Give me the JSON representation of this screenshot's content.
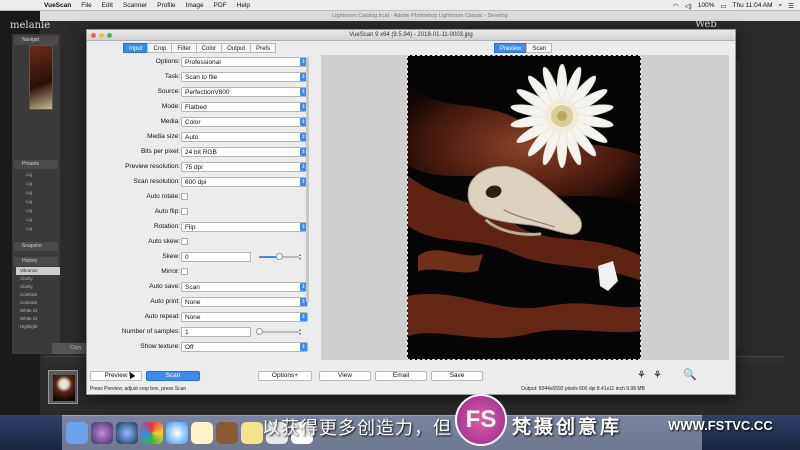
{
  "menubar": {
    "app": "VueScan",
    "items": [
      "File",
      "Edit",
      "Scanner",
      "Profile",
      "Image",
      "PDF",
      "Help"
    ],
    "battery": "100%",
    "clock": "Thu 11:04 AM"
  },
  "lightroom": {
    "window_title": "Lightroom Catalog.lrcat - Adobe Photoshop Lightroom Classic - Develop",
    "logo": "melanie",
    "module": "Web",
    "panels": {
      "navigator": "Navigat",
      "presets": "Presets",
      "snapshots": "Snapsho",
      "history": "History"
    },
    "presets_items": [
      "Lig",
      "Lig",
      "Lig",
      "Lig",
      "Lig",
      "Lig",
      "Lig"
    ],
    "history_items": [
      "Vibrance",
      "Clarity",
      "Clarity",
      "Contrast",
      "Contrast",
      "White Cl",
      "White Cl",
      "Highlight"
    ],
    "copy_label": "Copy"
  },
  "vuescan": {
    "title": "VueScan 9 x64 (9.5.94) - 2018-01-11-0003.jpg",
    "tabs": [
      "Input",
      "Crop",
      "Filter",
      "Color",
      "Output",
      "Prefs"
    ],
    "active_tab": "Input",
    "view_tabs": [
      "Preview",
      "Scan"
    ],
    "active_view": "Preview",
    "fields": [
      {
        "label": "Options:",
        "value": "Professional",
        "type": "select"
      },
      {
        "label": "Task:",
        "value": "Scan to file",
        "type": "select"
      },
      {
        "label": "Source:",
        "value": "PerfectionV800",
        "type": "select"
      },
      {
        "label": "Mode:",
        "value": "Flatbed",
        "type": "select"
      },
      {
        "label": "Media:",
        "value": "Color",
        "type": "select"
      },
      {
        "label": "Media size:",
        "value": "Auto",
        "type": "select"
      },
      {
        "label": "Bits per pixel:",
        "value": "24 bit RGB",
        "type": "select"
      },
      {
        "label": "Preview resolution:",
        "value": "75 dpi",
        "type": "select"
      },
      {
        "label": "Scan resolution:",
        "value": "600 dpi",
        "type": "select"
      },
      {
        "label": "Auto rotate:",
        "type": "checkbox"
      },
      {
        "label": "Auto flip:",
        "type": "checkbox"
      },
      {
        "label": "Rotation:",
        "value": "Flip",
        "type": "select"
      },
      {
        "label": "Auto skew:",
        "type": "checkbox"
      },
      {
        "label": "Skew:",
        "value": "0",
        "type": "slider",
        "level": 0.5
      },
      {
        "label": "Mirror:",
        "type": "checkbox"
      },
      {
        "label": "Auto save:",
        "value": "Scan",
        "type": "select"
      },
      {
        "label": "Auto print:",
        "value": "None",
        "type": "select"
      },
      {
        "label": "Auto repeat:",
        "value": "None",
        "type": "select"
      },
      {
        "label": "Number of samples:",
        "value": "1",
        "type": "slider",
        "level": 0.0
      },
      {
        "label": "Show texture:",
        "value": "Off",
        "type": "select"
      }
    ],
    "buttons": {
      "preview": "Preview",
      "scan": "Scan",
      "options": "Options+",
      "view": "View",
      "email": "Email",
      "save": "Save"
    },
    "status_left": "Press Preview, adjust crop box, press Scan",
    "status_right": "Output: 5044x6592 pixels 600 dpi 8.41x11 inch 9.98 MB"
  },
  "overlay": {
    "subtitle": "以获得更多创造力，但",
    "logo_letters": "FS",
    "site_name": "梵摄创意库",
    "site_url": "WWW.FSTVC.CC"
  },
  "colors": {
    "accent": "#3b8bf0",
    "lightroom_bg": "#2b2b2b",
    "window_bg": "#ececec"
  }
}
